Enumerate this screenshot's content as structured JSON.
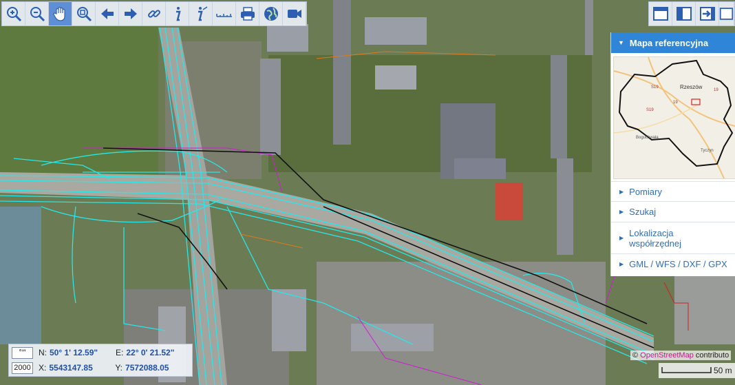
{
  "toolbar": {
    "tools": [
      {
        "icon": "zoom-in-icon"
      },
      {
        "icon": "zoom-out-icon"
      },
      {
        "icon": "pan-hand-icon",
        "active": true
      },
      {
        "icon": "zoom-window-icon"
      },
      {
        "icon": "back-arrow-icon"
      },
      {
        "icon": "forward-arrow-icon"
      },
      {
        "icon": "link-icon"
      },
      {
        "icon": "info-icon"
      },
      {
        "icon": "info-edit-icon"
      },
      {
        "icon": "ruler-icon"
      },
      {
        "icon": "print-icon"
      },
      {
        "icon": "globe-icon"
      },
      {
        "icon": "video-icon"
      }
    ],
    "right_tools": [
      {
        "icon": "layout-top-icon"
      },
      {
        "icon": "layout-split-icon"
      },
      {
        "icon": "export-arrow-icon"
      },
      {
        "icon": "layout-panel-icon"
      }
    ]
  },
  "panel": {
    "header": "Mapa referencyjna",
    "refmap_labels": {
      "city": "Rzeszów",
      "town_sw": "Boguchwała",
      "town_se": "Tyczyn",
      "roads": [
        "S19",
        "19",
        "S19",
        "19"
      ]
    },
    "items": [
      "Pomiary",
      "Szukaj",
      "Lokalizacja współrzędnej",
      "GML / WFS / DXF / GPX"
    ]
  },
  "coords": {
    "n_label": "N:",
    "n_value": "50° 1' 12.59\"",
    "e_label": "E:",
    "e_value": "22° 0' 21.52\"",
    "x_label": "X:",
    "x_value": "5543147.85",
    "y_label": "Y:",
    "y_value": "7572088.05",
    "scale_value": "2000"
  },
  "attribution": {
    "prefix": "©",
    "osm": "OpenStreetMap",
    "suffix": " contributo"
  },
  "scalebar": {
    "label": "50 m"
  },
  "colors": {
    "accent": "#2f86d8",
    "survey_lines": "#25e8e8",
    "panel_text": "#2f6fb8"
  }
}
